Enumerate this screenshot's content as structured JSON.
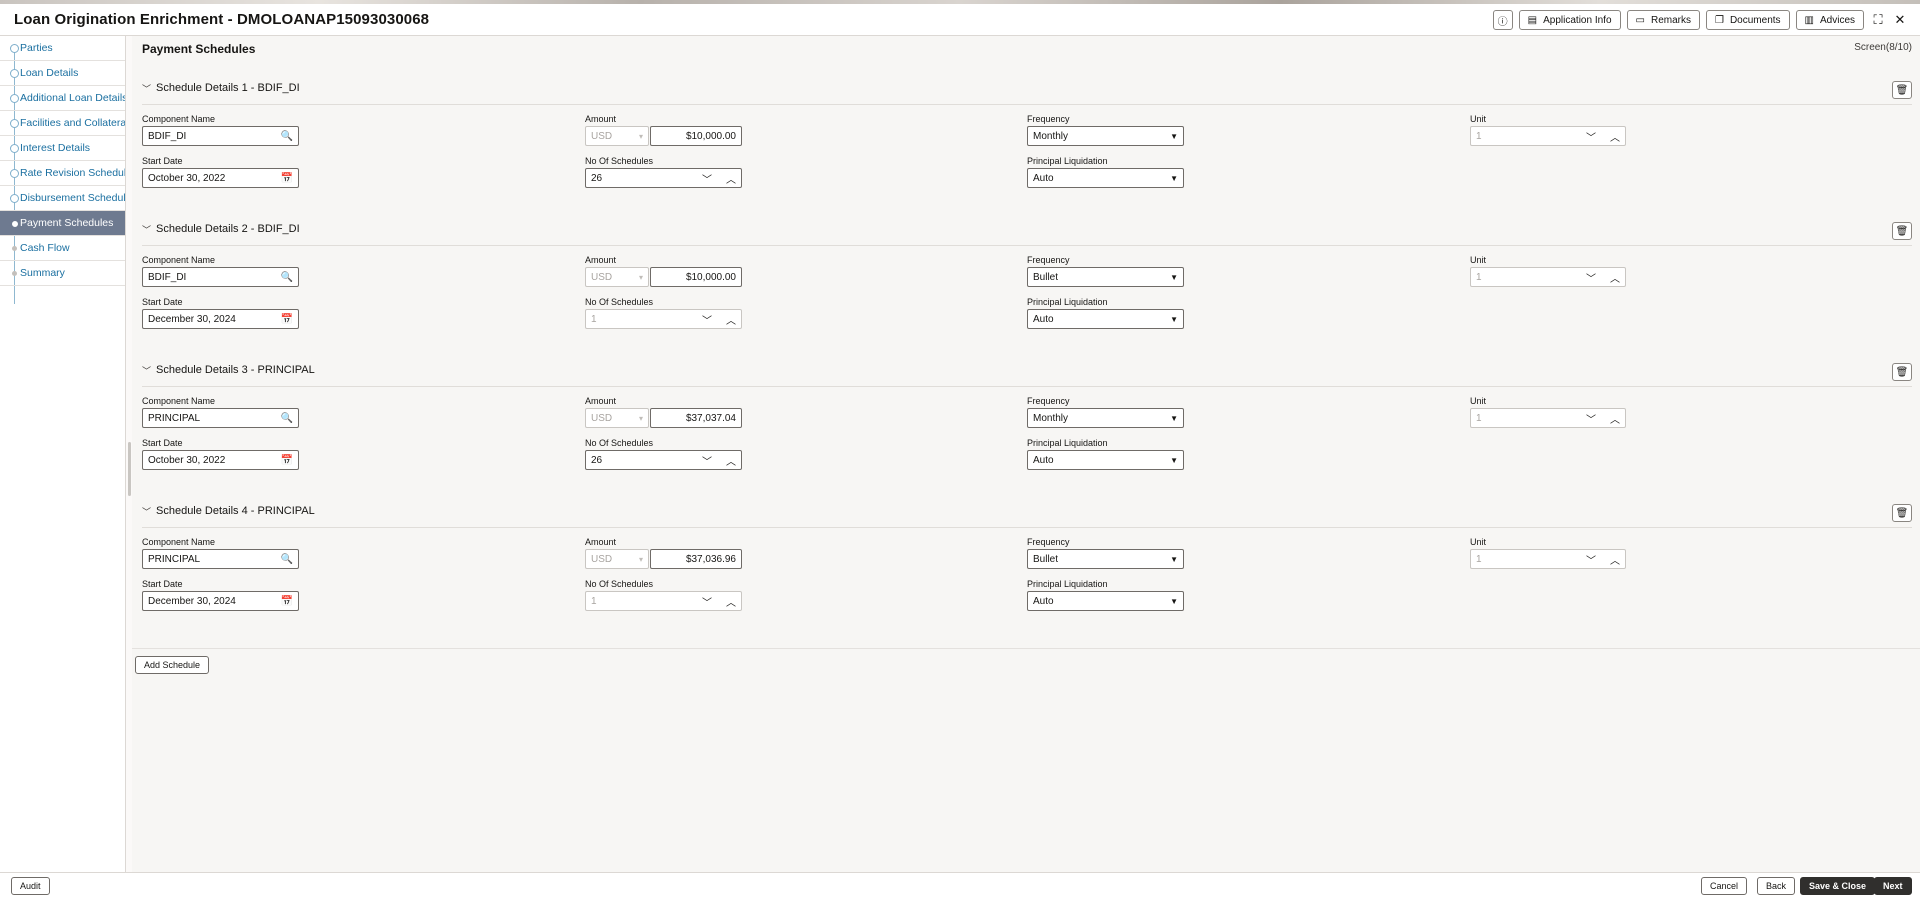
{
  "app": {
    "title": "Loan Origination Enrichment - DMOLOANAP15093030068"
  },
  "header_buttons": {
    "application_info": "Application Info",
    "remarks": "Remarks",
    "documents": "Documents",
    "advices": "Advices"
  },
  "sidebar": {
    "items": [
      {
        "label": "Parties",
        "state": "done"
      },
      {
        "label": "Loan Details",
        "state": "done"
      },
      {
        "label": "Additional Loan Details",
        "state": "done"
      },
      {
        "label": "Facilities and Collateral ...",
        "state": "done"
      },
      {
        "label": "Interest Details",
        "state": "done"
      },
      {
        "label": "Rate Revision Schedules",
        "state": "done"
      },
      {
        "label": "Disbursement Schedules",
        "state": "done"
      },
      {
        "label": "Payment Schedules",
        "state": "active"
      },
      {
        "label": "Cash Flow",
        "state": "pending"
      },
      {
        "label": "Summary",
        "state": "pending"
      }
    ]
  },
  "page": {
    "title": "Payment Schedules",
    "screen": "Screen(8/10)"
  },
  "labels": {
    "component_name": "Component Name",
    "amount": "Amount",
    "frequency": "Frequency",
    "unit": "Unit",
    "start_date": "Start Date",
    "no_of_schedules": "No Of Schedules",
    "principal_liquidation": "Principal Liquidation"
  },
  "schedules": [
    {
      "title": "Schedule Details 1  -  BDIF_DI",
      "component": "BDIF_DI",
      "currency": "USD",
      "amount": "$10,000.00",
      "frequency": "Monthly",
      "unit": "1",
      "start_date": "October 30, 2022",
      "no_of_schedules": "26",
      "principal_liquidation": "Auto"
    },
    {
      "title": "Schedule Details 2  -  BDIF_DI",
      "component": "BDIF_DI",
      "currency": "USD",
      "amount": "$10,000.00",
      "frequency": "Bullet",
      "unit": "1",
      "start_date": "December 30, 2024",
      "no_of_schedules": "1",
      "principal_liquidation": "Auto"
    },
    {
      "title": "Schedule Details 3  -  PRINCIPAL",
      "component": "PRINCIPAL",
      "currency": "USD",
      "amount": "$37,037.04",
      "frequency": "Monthly",
      "unit": "1",
      "start_date": "October 30, 2022",
      "no_of_schedules": "26",
      "principal_liquidation": "Auto"
    },
    {
      "title": "Schedule Details 4  -  PRINCIPAL",
      "component": "PRINCIPAL",
      "currency": "USD",
      "amount": "$37,036.96",
      "frequency": "Bullet",
      "unit": "1",
      "start_date": "December 30, 2024",
      "no_of_schedules": "1",
      "principal_liquidation": "Auto"
    }
  ],
  "actions": {
    "add_schedule": "Add Schedule",
    "audit": "Audit",
    "cancel": "Cancel",
    "back": "Back",
    "save_close": "Save & Close",
    "next": "Next"
  }
}
